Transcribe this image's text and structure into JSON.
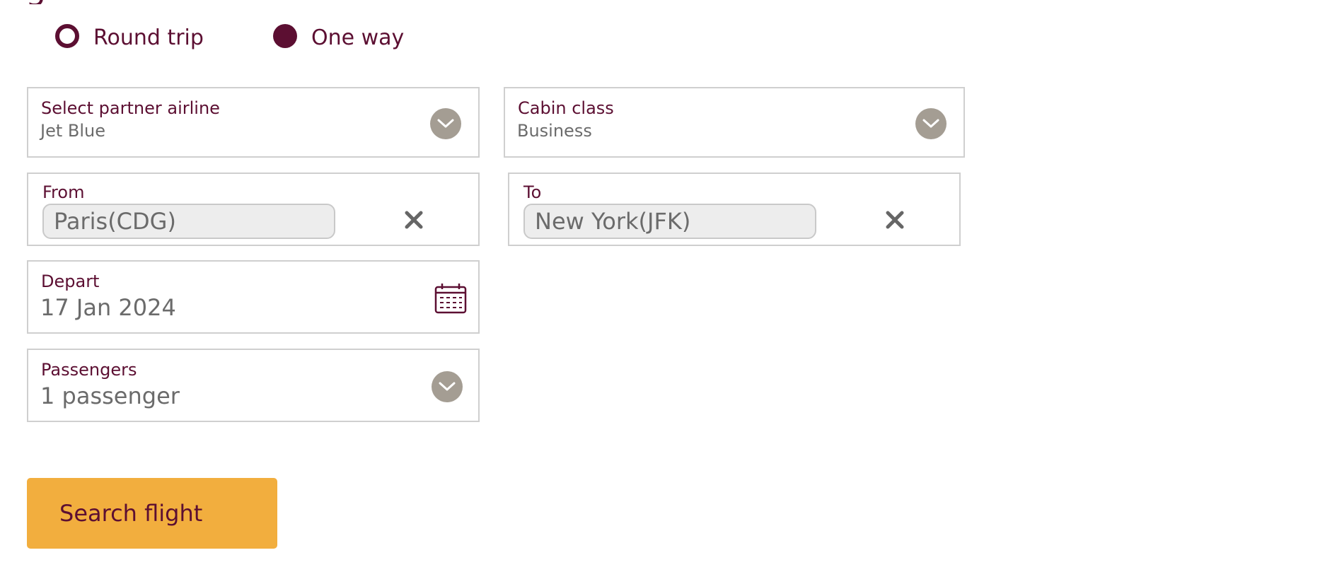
{
  "heading": {
    "fragment": "g"
  },
  "trip_type": {
    "options": [
      {
        "label": "Round trip",
        "selected": false
      },
      {
        "label": "One way",
        "selected": true
      }
    ]
  },
  "airline": {
    "label": "Select partner airline",
    "value": "Jet Blue"
  },
  "cabin": {
    "label": "Cabin class",
    "value": "Business"
  },
  "from": {
    "label": "From",
    "value": "Paris(CDG)"
  },
  "to": {
    "label": "To",
    "value": "New York(JFK)"
  },
  "depart": {
    "label": "Depart",
    "value": "17 Jan 2024"
  },
  "passengers": {
    "label": "Passengers",
    "value": "1 passenger"
  },
  "search": {
    "label": "Search flight"
  },
  "colors": {
    "brand": "#5c0f32",
    "button": "#f2ae3e",
    "chevron_bg": "#a49d93",
    "field_border": "#cfcfcf",
    "chip_bg": "#ededed"
  },
  "icons": {
    "chevron": "chevron-down-icon",
    "clear": "close-icon",
    "calendar": "calendar-icon"
  }
}
